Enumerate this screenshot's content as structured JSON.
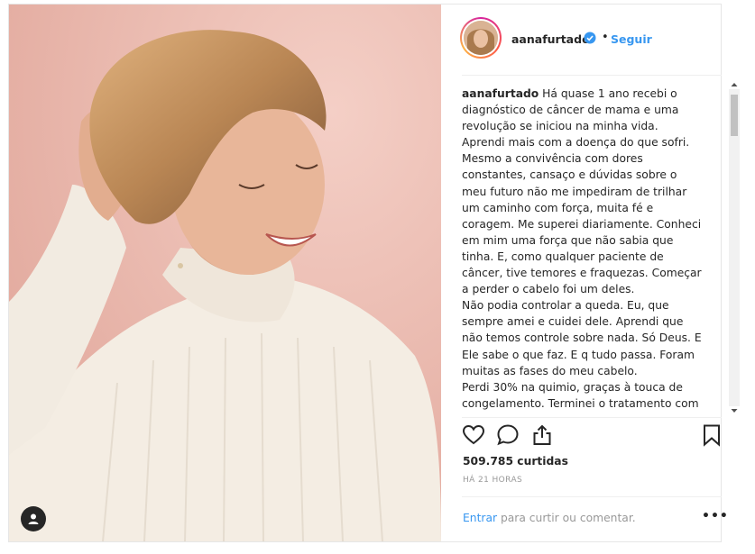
{
  "post": {
    "username": "aanafurtado",
    "separator": "•",
    "follow_label": "Seguir",
    "caption_text": "Há quase 1 ano recebi o diagnóstico de câncer de mama e uma revolução se iniciou na minha vida. Aprendi mais com a doença do que sofri. Mesmo a convivência com dores constantes, cansaço e dúvidas sobre o meu futuro não me impediram de trilhar um caminho com força, muita fé e coragem. Me superei diariamente. Conheci em mim uma força que não sabia que tinha. E, como qualquer paciente de câncer, tive temores e fraquezas. Começar a perder o cabelo foi um deles.\nNão podia controlar a queda. Eu, que sempre amei e cuidei dele. Aprendi que não temos controle sobre nada. Só Deus. E Ele sabe o que faz. E q tudo passa. Foram muitas as fases do meu cabelo.\nPerdi 30% na quimio, graças à touca de congelamento. Terminei o tratamento com",
    "likes": "509.785 curtidas",
    "timestamp": "HÁ 21 HORAS",
    "comment_login": "Entrar",
    "comment_rest": " para curtir ou comentar.",
    "more_label": "•••"
  },
  "colors": {
    "accent": "#3897f0",
    "verified": "#3897f0",
    "photo_background": "#eab9ae"
  },
  "icons": [
    "heart-icon",
    "comment-icon",
    "share-icon",
    "bookmark-icon",
    "user-tag-icon",
    "verified-badge-icon"
  ]
}
